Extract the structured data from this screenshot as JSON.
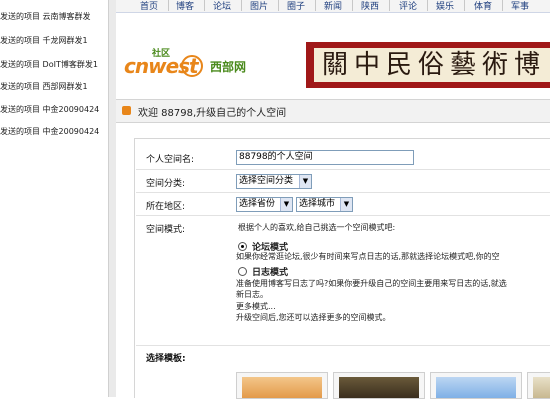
{
  "left_list": {
    "items": [
      "发送的项目 云南博客群发",
      "发送的项目 千龙网群发1",
      "发送的项目 DoIT博客群发1",
      "发送的项目 西部网群发1",
      "发送的项目 中金20090424",
      "发送的项目 中金20090424"
    ]
  },
  "top_nav": {
    "items": [
      "首页",
      "博客",
      "论坛",
      "图片",
      "圈子",
      "新闻",
      "陕西",
      "评论",
      "娱乐",
      "体育",
      "军事"
    ]
  },
  "logo": {
    "community": "社区",
    "brand": "cnwest",
    "cn_name": "西部网"
  },
  "banner": {
    "text": "關中民俗藝術博"
  },
  "welcome": {
    "text": "欢迎 88798,升级自己的个人空间"
  },
  "form": {
    "space_name_label": "个人空间名:",
    "space_name_value": "88798的个人空间",
    "category_label": "空间分类:",
    "category_select": "选择空间分类",
    "region_label": "所在地区:",
    "province_select": "选择省份",
    "city_select": "选择城市",
    "mode_label": "空间模式:",
    "mode_hint": "根据个人的喜欢,给自己挑选一个空间模式吧:",
    "forum_mode_title": "论坛模式",
    "forum_mode_desc": "如果你经常逛论坛,很少有时间来写点日志的话,那就选择论坛模式吧,你的空",
    "blog_mode_title": "日志模式",
    "blog_mode_desc_1": "准备使用博客写日志了吗?如果你要升级自己的空间主要用来写日志的话,就选",
    "blog_mode_desc_2": "新日志。",
    "more_modes": "更多模式...",
    "more_modes_desc": "升级空间后,您还可以选择更多的空间模式。",
    "template_label": "选择模板:"
  },
  "colors": {
    "brand_orange": "#e8861a",
    "brand_green": "#4a8a1c",
    "banner_red": "#a01818",
    "nav_text": "#1f3f7f"
  }
}
